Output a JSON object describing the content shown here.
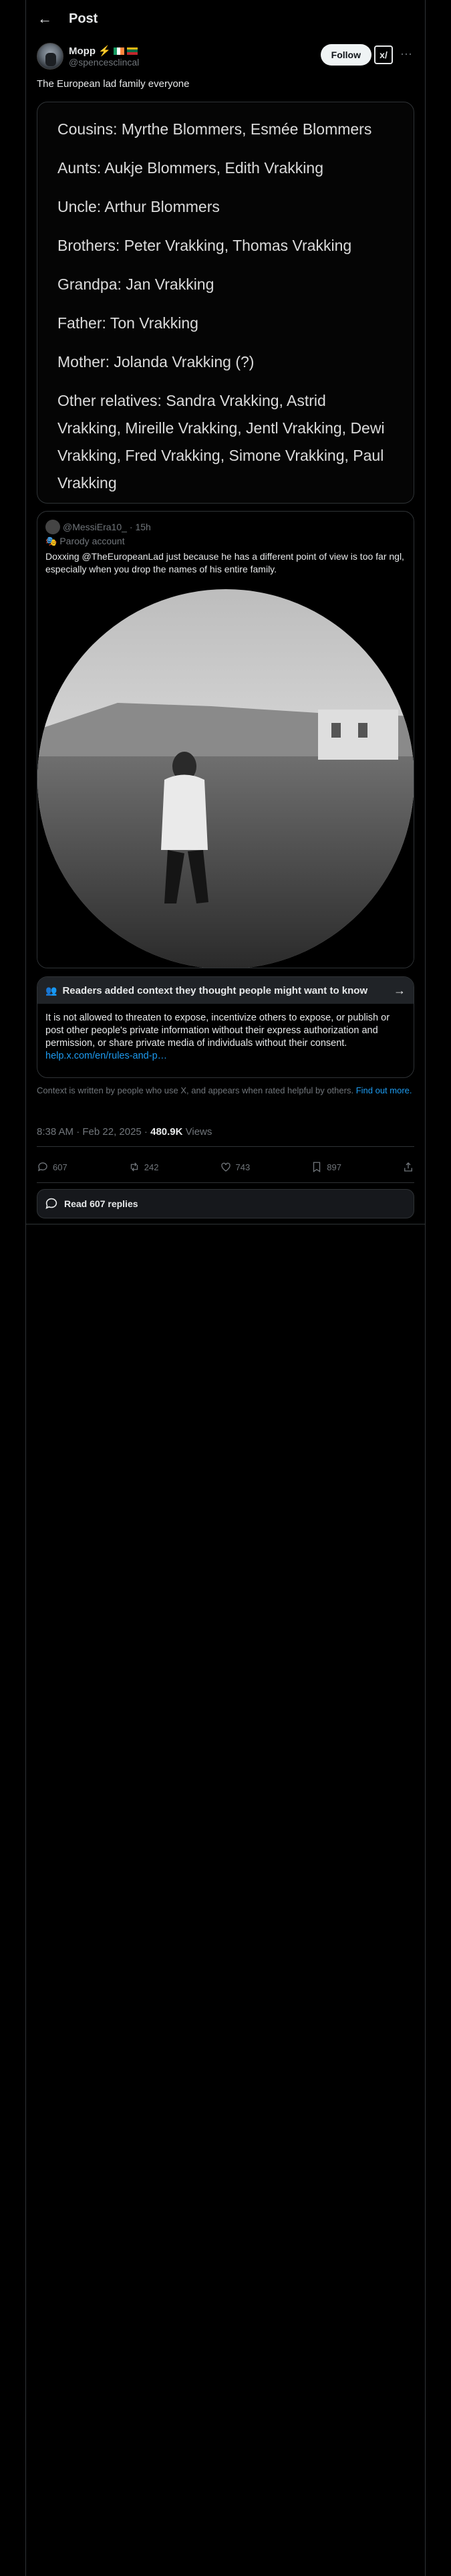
{
  "header": {
    "title": "Post",
    "back_icon": "arrow-left-icon"
  },
  "author": {
    "display_name": "Mopp",
    "emoji": "⚡",
    "flags": [
      {
        "name": "ireland-flag",
        "colors": [
          "#169b62",
          "#ffffff",
          "#ff883e"
        ]
      },
      {
        "name": "lithuania-flag",
        "colors": [
          "#fdb913",
          "#006a44",
          "#c1272d"
        ]
      }
    ],
    "handle": "@spencesclincal",
    "follow_label": "Follow",
    "grok_label": "x/",
    "more_label": "···"
  },
  "post": {
    "text": "The European lad family everyone"
  },
  "image_lines": [
    "Cousins: Myrthe Blommers, Esmée Blommers",
    "Aunts: Aukje Blommers, Edith Vrakking",
    "Uncle: Arthur Blommers",
    "Brothers: Peter Vrakking, Thomas Vrakking",
    "Grandpa: Jan Vrakking",
    "Father: Ton Vrakking",
    "Mother: Jolanda Vrakking (?)",
    "Other relatives:  Sandra Vrakking, Astrid Vrakking, Mireille Vrakking, Jentl Vrakking, Dewi Vrakking, Fred Vrakking, Simone Vrakking, Paul Vrakking"
  ],
  "quote": {
    "handle": "@MessiEra10_",
    "time": "· 15h",
    "tag": "Parody account",
    "text": "Doxxing @TheEuropeanLad just because he has a different point of view is too far ngl, especially when you drop the names of his entire family."
  },
  "community_note": {
    "title": "Readers added context they thought people might want to know",
    "body": "It is not allowed to threaten to expose, incentivize others to expose, or publish or post other people's private information without their express authorization and permission, or share private media of individuals without their consent.",
    "link": "help.x.com/en/rules-and-p…",
    "footer": "Context is written by people who use X, and appears when rated helpful by others.",
    "footer_link": "Find out more."
  },
  "meta": {
    "time": "8:38 AM · Feb 22, 2025 · ",
    "views": "480.9K",
    "views_label": " Views"
  },
  "actions": {
    "replies": "607",
    "reposts": "242",
    "likes": "743",
    "bookmarks": "897"
  },
  "read_replies": "Read 607 replies"
}
